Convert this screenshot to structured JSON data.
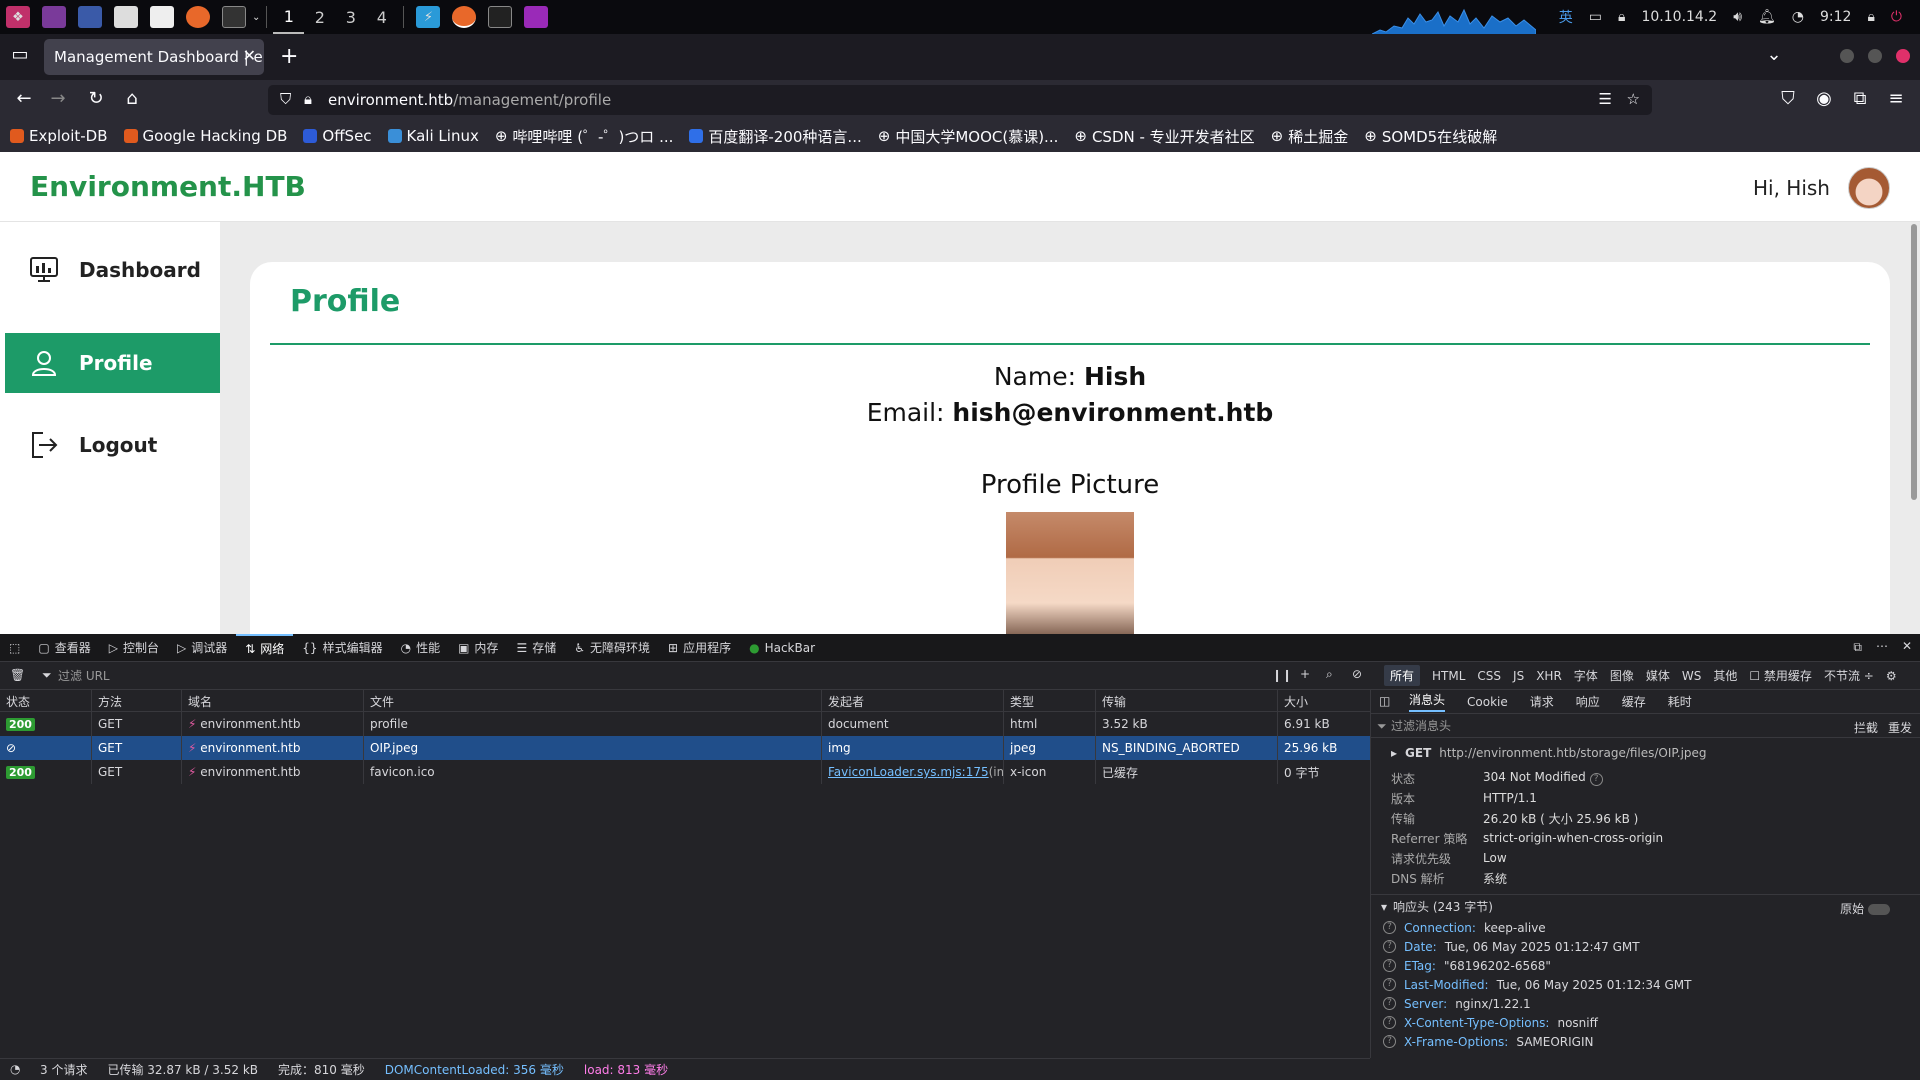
{
  "taskbar": {
    "workspaces": [
      "1",
      "2",
      "3",
      "4"
    ],
    "ip": "10.10.14.2",
    "ime": "英",
    "time": "9:12"
  },
  "browser": {
    "tab_title": "Management Dashboard | en",
    "url_host": "environment.htb",
    "url_path": "/management/profile",
    "bookmarks": [
      {
        "label": "Exploit-DB",
        "color": "#e05a1e"
      },
      {
        "label": "Google Hacking DB",
        "color": "#e05a1e"
      },
      {
        "label": "OffSec",
        "color": "#2d5bd8"
      },
      {
        "label": "Kali Linux",
        "color": "#3a8fd8"
      },
      {
        "label": "哔哩哔哩 (゜-゜)つロ ...",
        "color": "#aaaaaa"
      },
      {
        "label": "百度翻译-200种语言...",
        "color": "#2f6fe8"
      },
      {
        "label": "中国大学MOOC(慕课)...",
        "color": "#aaaaaa"
      },
      {
        "label": "CSDN - 专业开发者社区",
        "color": "#aaaaaa"
      },
      {
        "label": "稀土掘金",
        "color": "#aaaaaa"
      },
      {
        "label": "SOMD5在线破解",
        "color": "#aaaaaa"
      }
    ]
  },
  "site": {
    "brand": "Environment.HTB",
    "greeting": "Hi, Hish",
    "sidebar": [
      {
        "label": "Dashboard"
      },
      {
        "label": "Profile"
      },
      {
        "label": "Logout"
      }
    ],
    "card_title": "Profile",
    "name_label": "Name: ",
    "name_value": "Hish",
    "email_label": "Email: ",
    "email_value": "hish@environment.htb",
    "picture_label": "Profile Picture"
  },
  "devtools": {
    "tabs": [
      "查看器",
      "控制台",
      "调试器",
      "网络",
      "样式编辑器",
      "性能",
      "内存",
      "存储",
      "无障碍环境",
      "应用程序",
      "HackBar"
    ],
    "filter_placeholder": "过滤 URL",
    "types": [
      "所有",
      "HTML",
      "CSS",
      "JS",
      "XHR",
      "字体",
      "图像",
      "媒体",
      "WS",
      "其他"
    ],
    "disable_cache": "禁用缓存",
    "throttle": "不节流 ÷",
    "columns": [
      "状态",
      "方法",
      "域名",
      "文件",
      "发起者",
      "类型",
      "传输",
      "大小"
    ],
    "requests": [
      {
        "status": "200",
        "method": "GET",
        "domain": "environment.htb",
        "file": "profile",
        "initiator": "document",
        "initiator_extra": "",
        "type": "html",
        "transfer": "3.52 kB",
        "size": "6.91 kB"
      },
      {
        "status": "",
        "method": "GET",
        "domain": "environment.htb",
        "file": "OIP.jpeg",
        "initiator": "img",
        "initiator_extra": "",
        "type": "jpeg",
        "transfer": "NS_BINDING_ABORTED",
        "size": "25.96 kB"
      },
      {
        "status": "200",
        "method": "GET",
        "domain": "environment.htb",
        "file": "favicon.ico",
        "initiator": "FaviconLoader.sys.mjs:175",
        "initiator_extra": " (img)",
        "type": "x-icon",
        "transfer": "已缓存",
        "size": "0 字节"
      }
    ],
    "panel_tabs": [
      "消息头",
      "Cookie",
      "请求",
      "响应",
      "缓存",
      "耗时"
    ],
    "panel_filter": "过滤消息头",
    "panel_actions": [
      "拦截",
      "重发"
    ],
    "req_method": "GET",
    "req_url": "http://environment.htb/storage/files/OIP.jpeg",
    "details": [
      {
        "k": "状态",
        "v": "304 Not Modified"
      },
      {
        "k": "版本",
        "v": "HTTP/1.1"
      },
      {
        "k": "传输",
        "v": "26.20 kB ( 大小 25.96 kB )"
      },
      {
        "k": "Referrer 策略",
        "v": "strict-origin-when-cross-origin"
      },
      {
        "k": "请求优先级",
        "v": "Low"
      },
      {
        "k": "DNS 解析",
        "v": "系统"
      }
    ],
    "response_headers_title": "响应头 (243 字节)",
    "raw_label": "原始",
    "response_headers": [
      {
        "k": "Connection:",
        "v": "keep-alive"
      },
      {
        "k": "Date:",
        "v": "Tue, 06 May 2025 01:12:47 GMT"
      },
      {
        "k": "ETag:",
        "v": "\"68196202-6568\""
      },
      {
        "k": "Last-Modified:",
        "v": "Tue, 06 May 2025 01:12:34 GMT"
      },
      {
        "k": "Server:",
        "v": "nginx/1.22.1"
      },
      {
        "k": "X-Content-Type-Options:",
        "v": "nosniff"
      },
      {
        "k": "X-Frame-Options:",
        "v": "SAMEORIGIN"
      }
    ],
    "status_bar": {
      "requests": "3 个请求",
      "transferred": "已传输 32.87 kB / 3.52 kB",
      "finish": "完成：810 毫秒",
      "dcl": "DOMContentLoaded: 356 毫秒",
      "load": "load: 813 毫秒"
    }
  }
}
